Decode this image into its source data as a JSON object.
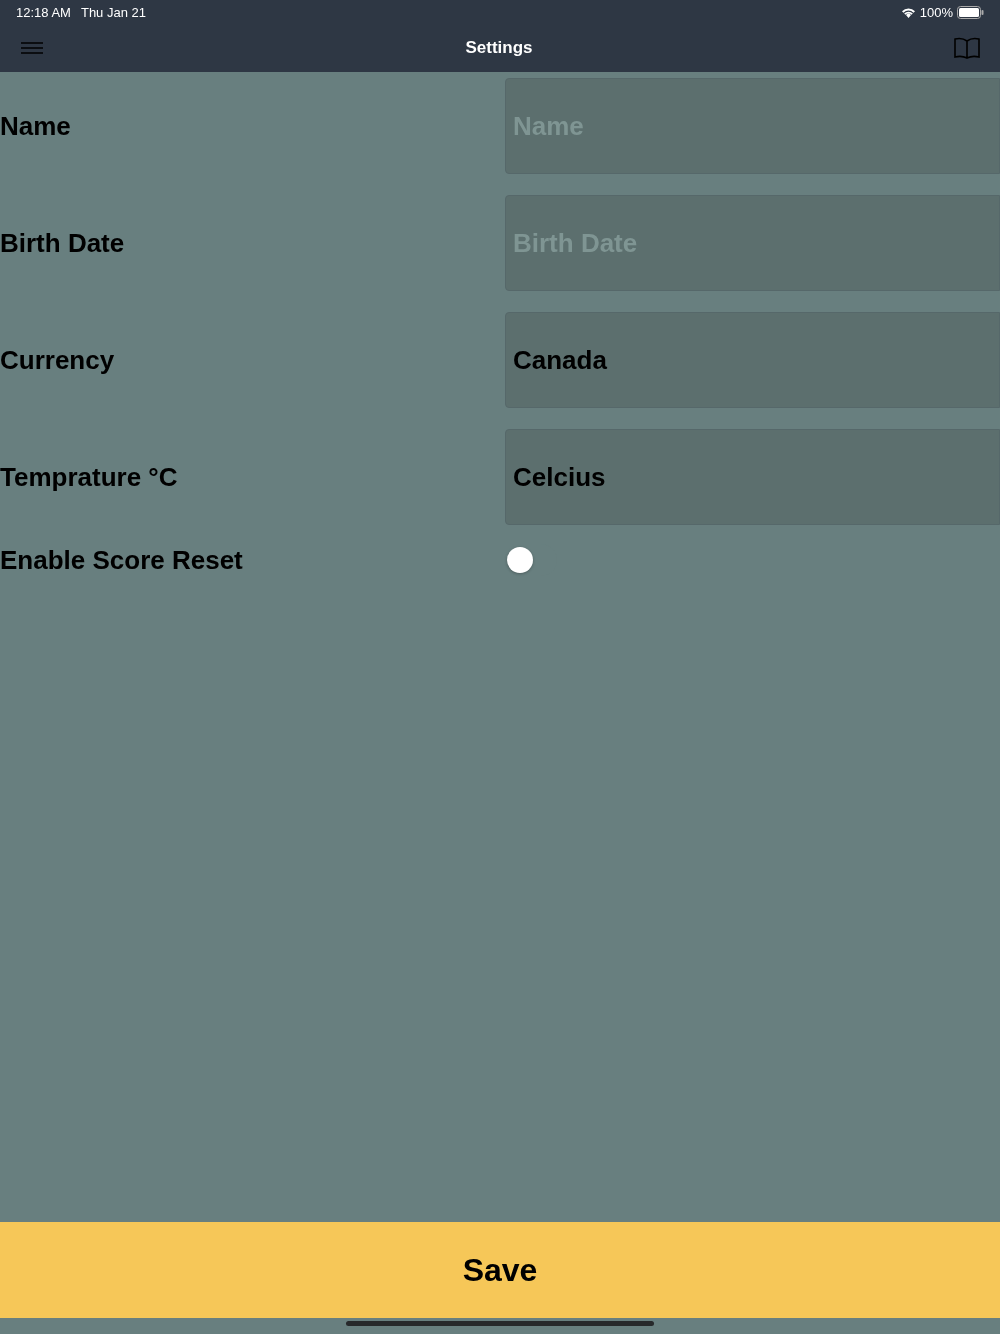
{
  "status_bar": {
    "time": "12:18 AM",
    "date": "Thu Jan 21",
    "battery": "100%"
  },
  "nav_bar": {
    "title": "Settings"
  },
  "rows": [
    {
      "kind": "field",
      "label": "Name",
      "placeholder": "Name"
    },
    {
      "kind": "field",
      "label": "Birth Date",
      "placeholder": "Birth Date"
    },
    {
      "kind": "field",
      "label": "Currency",
      "value": "Canada"
    },
    {
      "kind": "field",
      "label": "Temprature °C",
      "value": "Celcius"
    },
    {
      "kind": "toggle",
      "label": "Enable Score Reset",
      "on": false
    }
  ],
  "save_button": {
    "label": "Save"
  }
}
